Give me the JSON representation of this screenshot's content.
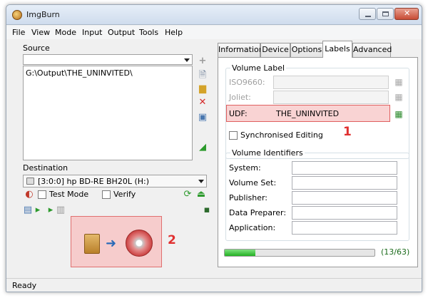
{
  "window": {
    "title": "ImgBurn"
  },
  "menu": [
    "File",
    "View",
    "Mode",
    "Input",
    "Output",
    "Tools",
    "Help"
  ],
  "source": {
    "label": "Source",
    "items": [
      "G:\\Output\\THE_UNINVITED\\"
    ]
  },
  "destination": {
    "label": "Destination",
    "drive": "[3:0:0] hp BD-RE  BH20L (H:)",
    "test_mode_label": "Test Mode",
    "verify_label": "Verify"
  },
  "tabs": [
    "Information",
    "Device",
    "Options",
    "Labels",
    "Advanced"
  ],
  "active_tab": "Labels",
  "volume_label": {
    "title": "Volume Label",
    "iso9660_label": "ISO9660:",
    "joliet_label": "Joliet:",
    "udf_label": "UDF:",
    "udf_value": "THE_UNINVITED",
    "sync_editing_label": "Synchronised Editing"
  },
  "volume_identifiers": {
    "title": "Volume Identifiers",
    "fields": [
      "System:",
      "Volume Set:",
      "Publisher:",
      "Data Preparer:",
      "Application:"
    ]
  },
  "progress": {
    "fraction": 0.206,
    "text": "(13/63)"
  },
  "annotations": {
    "marker_1": "1",
    "marker_2": "2"
  },
  "status": {
    "text": "Ready"
  },
  "colors": {
    "highlight_border": "#e06060",
    "highlight_fill": "#f9d3d3",
    "progress": "#22b022"
  }
}
